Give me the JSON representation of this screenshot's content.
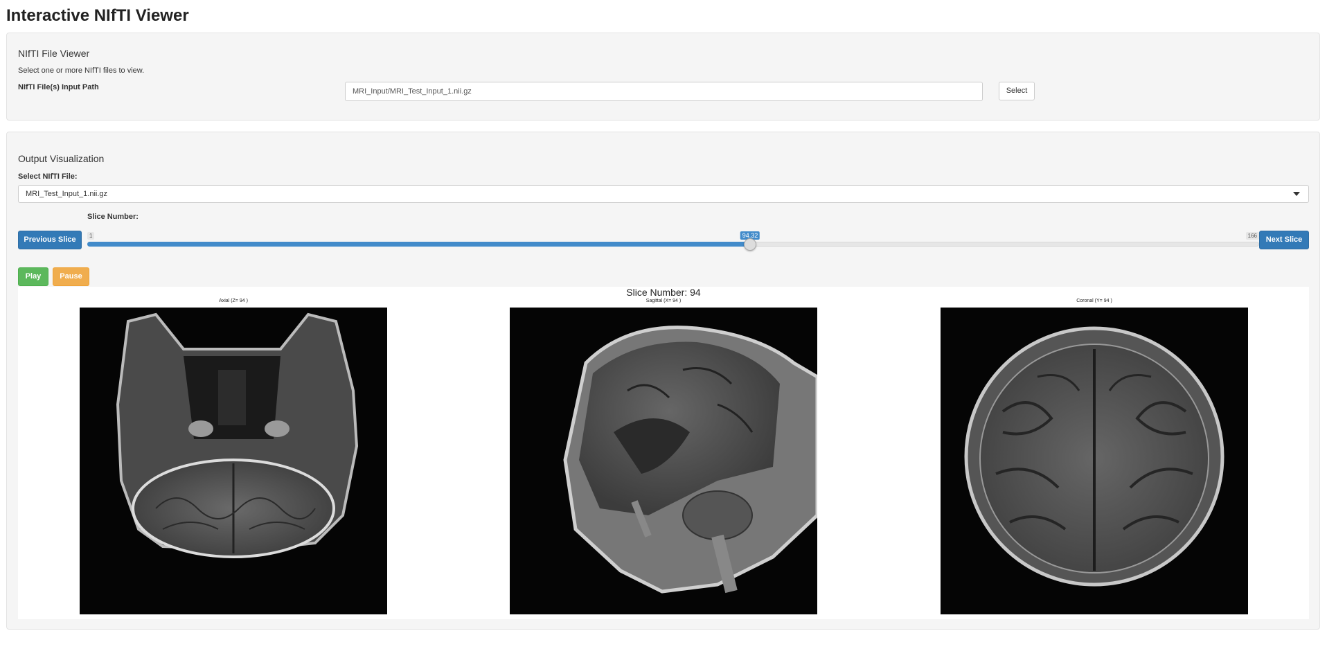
{
  "app": {
    "title": "Interactive NIfTI Viewer"
  },
  "input_panel": {
    "title": "NIfTI File Viewer",
    "help": "Select one or more NIfTI files to view.",
    "path_label": "NIfTI File(s) Input Path",
    "path_value": "MRI_Input/MRI_Test_Input_1.nii.gz",
    "select_button": "Select"
  },
  "output_panel": {
    "title": "Output Visualization",
    "file_label": "Select NIfTI File:",
    "file_selected": "MRI_Test_Input_1.nii.gz",
    "slice_label": "Slice Number:",
    "prev_button": "Previous Slice",
    "next_button": "Next Slice",
    "play_button": "Play",
    "pause_button": "Pause",
    "slider": {
      "min": 1,
      "max": 166,
      "value": 94.32,
      "min_label": "1",
      "max_label": "166",
      "value_label": "94.32"
    },
    "accent_color": "#337ab7"
  },
  "visualization": {
    "title": "Slice Number: 94",
    "views": [
      {
        "title": "Axial (Z= 94 )",
        "icon": "axial-mri-image"
      },
      {
        "title": "Sagittal (X= 94 )",
        "icon": "sagittal-mri-image"
      },
      {
        "title": "Coronal (Y= 94 )",
        "icon": "coronal-mri-image"
      }
    ]
  }
}
